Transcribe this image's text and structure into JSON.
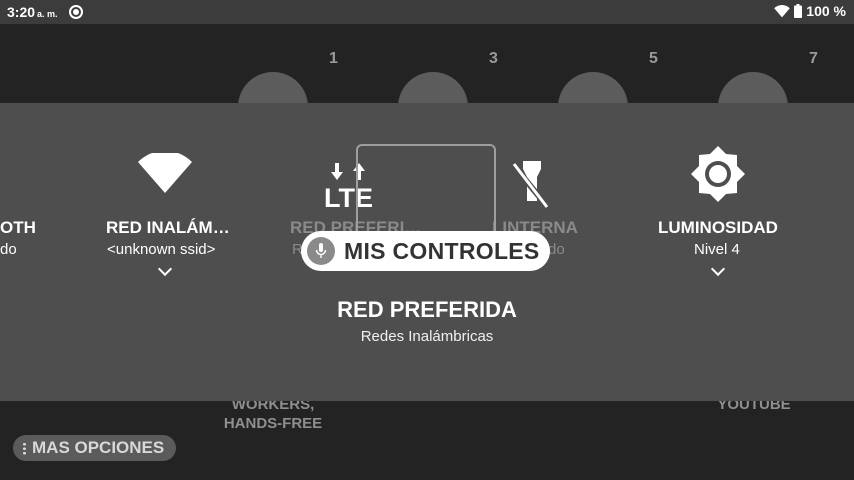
{
  "status_bar": {
    "time": "3:20",
    "ampm": "a. m.",
    "icons": [
      "radio-icon",
      "wifi-icon",
      "battery-icon"
    ],
    "battery": "100 %"
  },
  "background": {
    "page_numbers": [
      "1",
      "3",
      "5",
      "7"
    ],
    "app_labels": [
      "WORKERS,",
      "HANDS-FREE",
      "YOUTUBE"
    ],
    "more_options": "MAS OPCIONES"
  },
  "quick_settings": {
    "tiles": [
      {
        "label": "OTH",
        "sub": "do",
        "icon": "bluetooth-icon"
      },
      {
        "label": "RED INALÁM…",
        "sub": "<unknown ssid>",
        "icon": "wifi-icon"
      },
      {
        "label": "RED PREFERI…",
        "sub": "R",
        "icon": "lte-icon",
        "lte_text": "LTE"
      },
      {
        "label": "LINTERNA",
        "sub": "do",
        "icon": "flashlight-off-icon"
      },
      {
        "label": "LUMINOSIDAD",
        "sub": "Nivel 4",
        "icon": "brightness-icon"
      }
    ],
    "voice_pill": "MIS CONTROLES",
    "focused_title": "RED PREFERIDA",
    "focused_subtitle": "Redes Inalámbricas"
  },
  "colors": {
    "panel": "#4e4e4e",
    "status_bar": "#3c3c3c",
    "background": "#232323",
    "pill": "#ffffff"
  }
}
